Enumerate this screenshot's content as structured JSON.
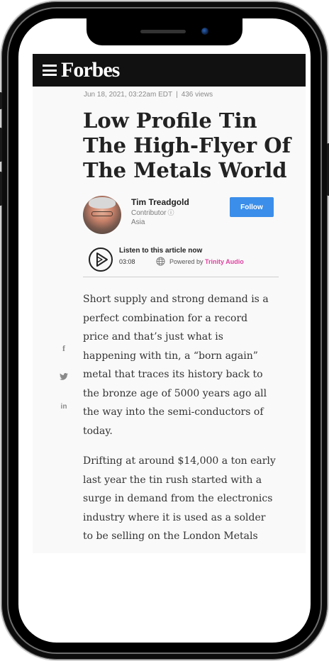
{
  "site": {
    "logo": "Forbes",
    "menu_icon": "hamburger-icon"
  },
  "article": {
    "date": "Jun 18, 2021, 03:22am EDT",
    "separator": "|",
    "views": "436 views",
    "headline": "Low Profile Tin The High-Flyer Of The Metals World",
    "author": {
      "name": "Tim Treadgold",
      "role": "Contributor",
      "role_icon": "info-icon",
      "region": "Asia",
      "follow_label": "Follow"
    },
    "audio": {
      "title": "Listen to this article now",
      "duration": "03:08",
      "powered_by": "Powered by",
      "brand": "Trinity Audio"
    },
    "share_icons": [
      "facebook-icon",
      "twitter-icon",
      "linkedin-icon"
    ],
    "paragraphs": [
      "Short supply and strong demand is a perfect combination for a record price and that’s just what is happening with tin, a “born again” metal that traces its history back to the bronze age of 5000 years ago all the way into the semi-conductors of today.",
      "Drifting at around $14,000 a ton early last year the tin rush started with a surge in demand from the electronics industry where it is used as a solder to be selling on the London Metals"
    ]
  },
  "colors": {
    "follow_button": "#3b8ee9",
    "audio_brand": "#e040a0",
    "topbar": "#111111"
  }
}
